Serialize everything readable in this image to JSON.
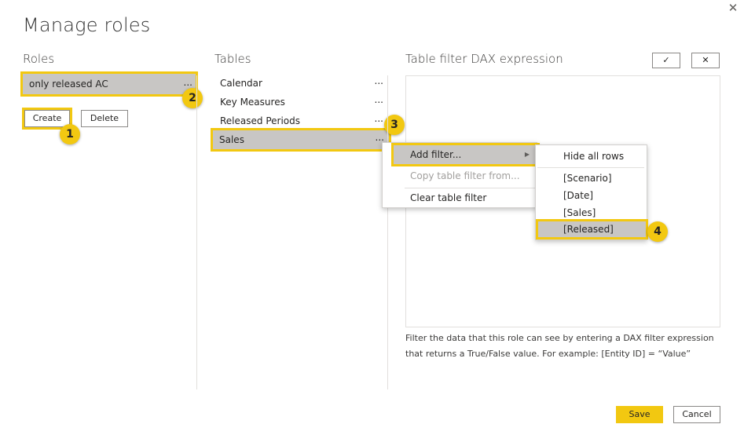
{
  "dialog": {
    "title": "Manage roles"
  },
  "roles": {
    "heading": "Roles",
    "selected_role": "only released AC",
    "more": "...",
    "create_label": "Create",
    "delete_label": "Delete"
  },
  "tables": {
    "heading": "Tables",
    "items": [
      {
        "label": "Calendar",
        "more": "..."
      },
      {
        "label": "Key Measures",
        "more": "..."
      },
      {
        "label": "Released Periods",
        "more": "..."
      },
      {
        "label": "Sales",
        "more": "..."
      }
    ]
  },
  "context_menu": {
    "items": [
      {
        "label": "Add filter...",
        "arrow": "▶"
      },
      {
        "label": "Copy table filter from..."
      },
      {
        "label": "Clear table filter"
      }
    ]
  },
  "submenu": {
    "items": [
      {
        "label": "Hide all rows"
      },
      {
        "label": "[Scenario]"
      },
      {
        "label": "[Date]"
      },
      {
        "label": "[Sales]"
      },
      {
        "label": "[Released]"
      }
    ]
  },
  "dax": {
    "heading": "Table filter DAX expression",
    "confirm_glyph": "✓",
    "cancel_glyph": "✕",
    "hint": "Filter the data that this role can see by entering a DAX filter expression that returns a True/False value. For example: [Entity ID] = “Value”"
  },
  "steps": [
    "1",
    "2",
    "3",
    "4"
  ],
  "footer": {
    "save_label": "Save",
    "cancel_label": "Cancel"
  },
  "close_glyph": "✕",
  "colors": {
    "accent": "#f2c811",
    "selection": "#c8c6c4"
  }
}
